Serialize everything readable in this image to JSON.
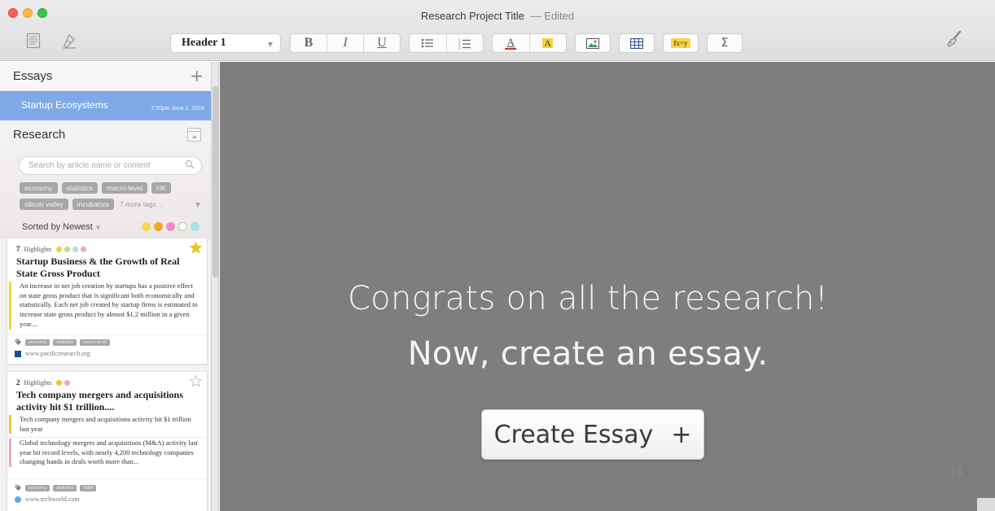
{
  "window": {
    "title": "Research Project Title",
    "edited_label": "— Edited"
  },
  "toolbar": {
    "left_icons": [
      "document-icon",
      "highlighter-icon"
    ],
    "paragraph_style": "Header 1",
    "bold_label": "B",
    "italic_label": "I",
    "underline_label": "U",
    "text_color_label": "A",
    "highlight_label": "A",
    "formula_label": "fx=y",
    "sum_label": "Σ",
    "right_icon": "paintbrush-icon"
  },
  "sidebar": {
    "essays_label": "Essays",
    "essays": [
      {
        "name": "Startup Ecosystems",
        "date": "7:30pm June 1, 2016",
        "selected": true
      }
    ],
    "research_label": "Research",
    "search_placeholder": "Search by article name or content",
    "tags_row1": [
      "economy",
      "statistics",
      "macro-level",
      "HK"
    ],
    "tags_row2": [
      "silicon valley",
      "incubators"
    ],
    "more_tags": "7 more tags ...",
    "sort_label": "Sorted by Newest",
    "filter_colors": [
      "#f9d84a",
      "#f6a623",
      "#f28bc3",
      "#b6ecb6",
      "#9fe6ea"
    ],
    "cards": [
      {
        "highlights_count": "7",
        "highlights_label": "Highlights",
        "highlight_colors": [
          "#f5d335",
          "#b9e07a",
          "#a7e3f0",
          "#f3a1c8"
        ],
        "starred": true,
        "title": "Startup Business & the Growth of Real State Gross Product",
        "excerpts": [
          {
            "text": "An increase in net job creation by startups has a positive effect on state gross product that is significant both economically and statistically. Each net job created by startup firms is estimated to increase state gross product by almost $1.2 million in a given year....",
            "color": "#f5d335"
          }
        ],
        "tags": [
          "economy",
          "statistics",
          "macro-level"
        ],
        "source": "www.pacificresearch.org"
      },
      {
        "highlights_count": "2",
        "highlights_label": "Highlights",
        "highlight_colors": [
          "#f5c22a",
          "#f3a1c8"
        ],
        "starred": false,
        "title": "Tech company mergers and acquisitions activity hit $1 trillion....",
        "excerpts": [
          {
            "text": "Tech company mergers and acquisitions activity hit $1 trillion last year",
            "color": "#f5c22a"
          },
          {
            "text": "Global technology mergers and acquisitions (M&A) activity last year hit record levels, with nearly 4,200 technology companies changing hands in deals worth more than...",
            "color": "#f3a1c8"
          }
        ],
        "tags": [
          "economy",
          "statistics",
          "M&A"
        ],
        "source": "www.techworld.com"
      }
    ]
  },
  "main": {
    "message_line1": "Congrats on all the research!",
    "message_line2": "Now, create an essay.",
    "create_button_label": "Create Essay",
    "create_button_plus": "+",
    "page_number": "14"
  }
}
